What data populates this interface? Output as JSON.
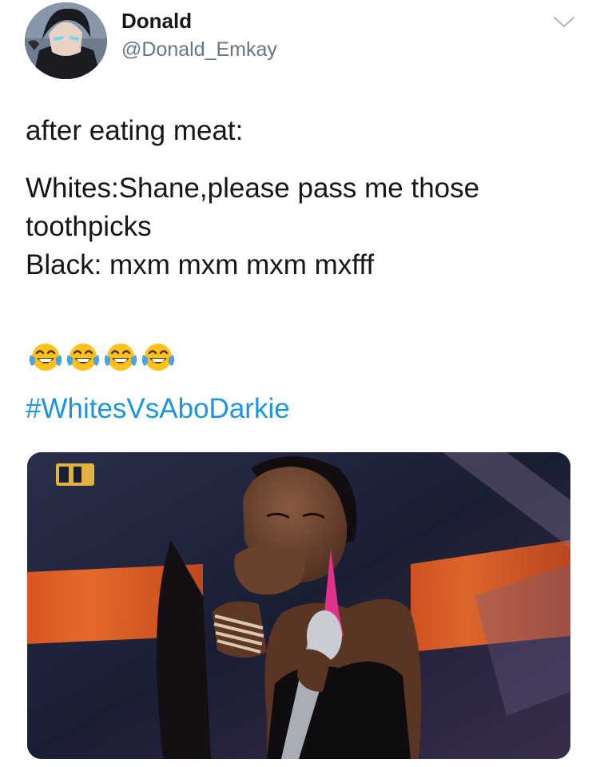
{
  "tweet": {
    "author": {
      "display_name": "Donald",
      "handle": "@Donald_Emkay",
      "avatar_icon": "anime-character-avatar"
    },
    "menu_icon": "chevron-down-icon",
    "text_lines": [
      "after eating meat:",
      "Whites:Shane,please pass me those",
      "toothpicks",
      "Black: mxm mxm mxm mxfff"
    ],
    "emojis": [
      "face-with-tears-of-joy",
      "face-with-tears-of-joy",
      "face-with-tears-of-joy",
      "face-with-tears-of-joy"
    ],
    "hashtag": "#WhitesVsAboDarkie",
    "media": {
      "description_icon": "photo-woman-covering-mouth-holding-microphone",
      "channel_logo_icon": "tv-channel-logo"
    }
  },
  "colors": {
    "text": "#14171a",
    "secondary_text": "#657786",
    "link": "#1b95e0",
    "emoji_yellow": "#fcc21b",
    "tears_blue": "#4aa3df"
  }
}
